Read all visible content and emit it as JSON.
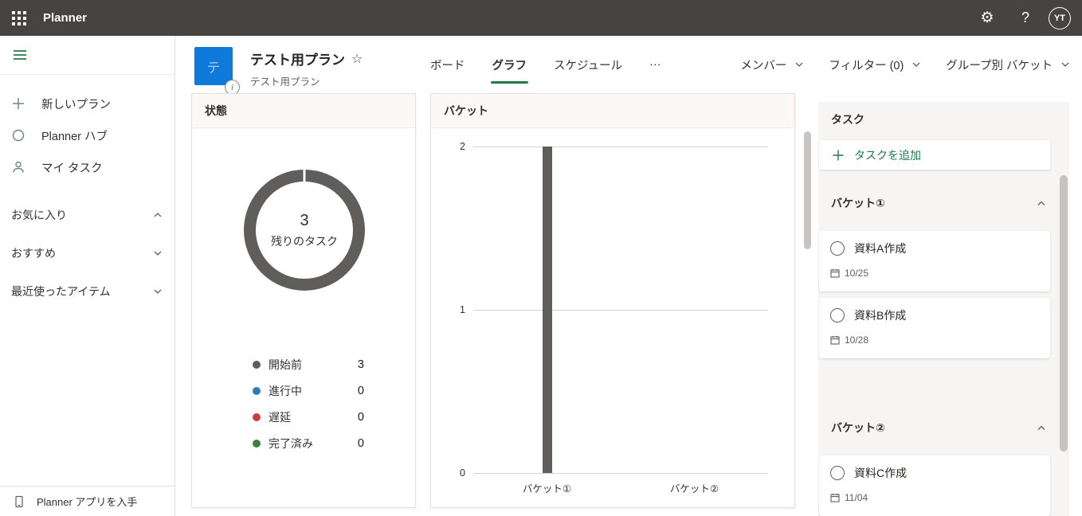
{
  "theme": {
    "topbar_bg": "#464441",
    "accent_green": "#217a4c",
    "plan_icon_blue": "#0f7ad9",
    "chart_gray": "#5f5e5c",
    "card_header_bg": "#faf9f8",
    "panel_bg": "#f6f5f3",
    "scrollbar_thumb": "#c8c6c4"
  },
  "topbar": {
    "app_title": "Planner",
    "help_label": "?",
    "avatar_initials": "YT"
  },
  "sidebar": {
    "items": [
      {
        "label": "新しいプラン",
        "icon": "plus-icon"
      },
      {
        "label": "Planner ハブ",
        "icon": "circle-icon"
      },
      {
        "label": "マイ タスク",
        "icon": "person-icon"
      }
    ],
    "sections": [
      {
        "label": "お気に入り",
        "state": "expanded"
      },
      {
        "label": "おすすめ",
        "state": "collapsed"
      },
      {
        "label": "最近使ったアイテム",
        "state": "collapsed"
      }
    ],
    "footer": {
      "label": "Planner アプリを入手",
      "icon": "phone-icon"
    }
  },
  "plan_header": {
    "icon_letter": "テ",
    "title": "テスト用プラン",
    "favorite_icon": "☆",
    "subtitle": "テスト用プラン",
    "info_badge": "i"
  },
  "tabs": [
    {
      "label": "ボード",
      "active": false
    },
    {
      "label": "グラフ",
      "active": true
    },
    {
      "label": "スケジュール",
      "active": false
    },
    {
      "label": "···",
      "active": false
    }
  ],
  "view_controls": [
    {
      "label": "メンバー"
    },
    {
      "label": "フィルター (0)"
    },
    {
      "label": "グループ別 バケット"
    }
  ],
  "status_card": {
    "title": "状態"
  },
  "bucket_card": {
    "title": "バケット"
  },
  "tasks_panel": {
    "title": "タスク",
    "add_task_label": "タスクを追加",
    "sections": [
      {
        "label": "バケット①",
        "tasks": [
          {
            "title": "資料A作成",
            "due": "10/25"
          },
          {
            "title": "資料B作成",
            "due": "10/28"
          }
        ]
      },
      {
        "label": "バケット②",
        "tasks": [
          {
            "title": "資料C作成",
            "due": "11/04"
          }
        ]
      }
    ]
  },
  "chart_data": [
    {
      "type": "pie",
      "donut": true,
      "title": "状態",
      "center_value": "3",
      "center_label": "残りのタスク",
      "categories": [
        "開始前",
        "進行中",
        "遅延",
        "完了済み"
      ],
      "values": [
        3,
        0,
        0,
        0
      ],
      "colors": [
        "#5d5b59",
        "#2e7db4",
        "#d03b3f",
        "#3d7d3f"
      ],
      "legend_position": "bottom"
    },
    {
      "type": "bar",
      "title": "バケット",
      "categories": [
        "バケット①",
        "バケット②"
      ],
      "values": [
        2,
        0
      ],
      "bar_color": "#5f5e5c",
      "ylim": [
        0,
        2
      ],
      "yticks": [
        0,
        1,
        2
      ],
      "grid": true,
      "xlabel": "",
      "ylabel": ""
    }
  ]
}
